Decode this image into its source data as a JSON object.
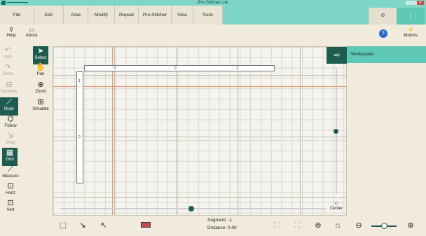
{
  "window": {
    "title": "Pro-Stitcher Lite"
  },
  "menu": {
    "items": [
      {
        "id": "file",
        "label": "File"
      },
      {
        "id": "edit",
        "label": "Edit"
      },
      {
        "id": "area",
        "label": "Area"
      },
      {
        "id": "modify",
        "label": "Modify"
      },
      {
        "id": "repeat",
        "label": "Repeat"
      },
      {
        "id": "pro",
        "label": "Pro-Stitcher"
      },
      {
        "id": "view",
        "label": "View"
      },
      {
        "id": "tools",
        "label": "Tools"
      }
    ],
    "right_icons": [
      "settings-icon",
      "info-icon"
    ]
  },
  "toolbar": {
    "help_label": "Help",
    "about_label": "About",
    "motors_label": "Motors"
  },
  "left_tools": {
    "undo": "Undo",
    "select": "Select",
    "redo": "Redo",
    "pan": "Pan",
    "baseline": "Baseline",
    "zoom": "Zoom",
    "ruler": "Ruler",
    "simulate": "Simulate",
    "follow": "Follow",
    "drag": "Drag",
    "grid": "Grid",
    "measure": "Measure",
    "horiz": "Horiz",
    "vert": "Vert"
  },
  "ruler": {
    "h_ticks": [
      "-1",
      "0",
      "1"
    ],
    "v_ticks": [
      "1",
      "0"
    ]
  },
  "right_panel": {
    "workspace_label": "Workspace",
    "center_label": "Center"
  },
  "status": {
    "segment_label": "Segment:",
    "segment_value": "-1",
    "distance_label": "Distance:",
    "distance_value": "0.00"
  },
  "colors": {
    "accent": "#7fd6c8",
    "dark_teal": "#1e5c4f",
    "workspace_teal": "#5fc7b5",
    "guide_orange": "#e8956b",
    "background": "#f0ebdc"
  }
}
